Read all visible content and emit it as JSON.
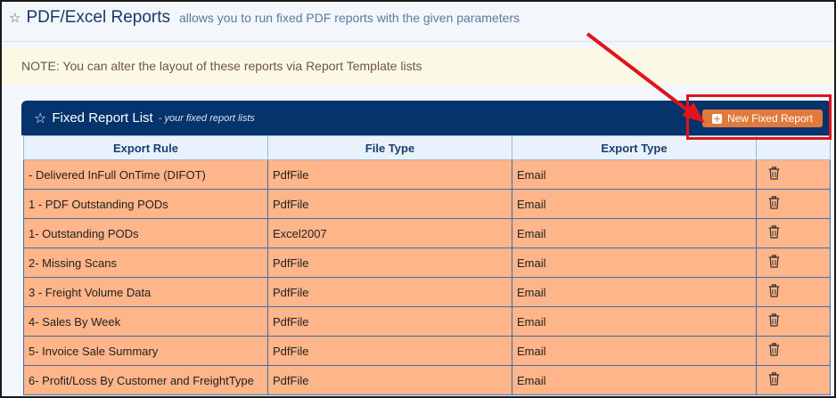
{
  "header": {
    "title": "PDF/Excel Reports",
    "subtitle": "allows you to run fixed PDF reports with the given parameters"
  },
  "note": "NOTE: You can alter the layout of these reports via Report Template lists",
  "panel": {
    "title": "Fixed Report List",
    "subtitle": "- your fixed report lists",
    "new_button_label": "New Fixed Report"
  },
  "table": {
    "columns": [
      "Export Rule",
      "File Type",
      "Export Type",
      ""
    ],
    "rows": [
      {
        "rule": "- Delivered InFull OnTime (DIFOT)",
        "file_type": "PdfFile",
        "export_type": "Email"
      },
      {
        "rule": "1 - PDF Outstanding PODs",
        "file_type": "PdfFile",
        "export_type": "Email"
      },
      {
        "rule": "1- Outstanding PODs",
        "file_type": "Excel2007",
        "export_type": "Email"
      },
      {
        "rule": "2- Missing Scans",
        "file_type": "PdfFile",
        "export_type": "Email"
      },
      {
        "rule": "3 - Freight Volume Data",
        "file_type": "PdfFile",
        "export_type": "Email"
      },
      {
        "rule": "4- Sales By Week",
        "file_type": "PdfFile",
        "export_type": "Email"
      },
      {
        "rule": "5- Invoice Sale Summary",
        "file_type": "PdfFile",
        "export_type": "Email"
      },
      {
        "rule": "6- Profit/Loss By Customer and FreightType",
        "file_type": "PdfFile",
        "export_type": "Email"
      }
    ]
  },
  "colors": {
    "panel_header": "#05336b",
    "row_fill": "#fdb589",
    "button": "#e07a3c",
    "annotation": "#e0141c"
  },
  "icons": [
    "star-icon",
    "plus-icon",
    "trash-icon"
  ]
}
